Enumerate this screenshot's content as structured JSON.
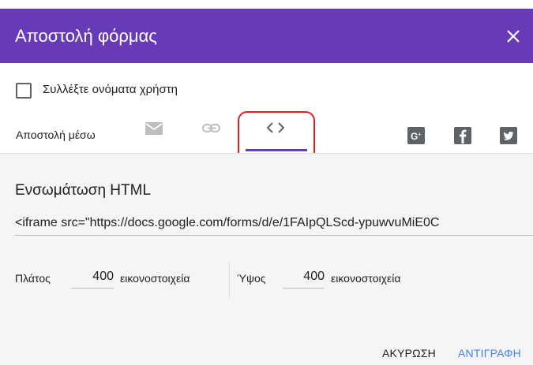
{
  "dialog": {
    "title": "Αποστολή φόρμας",
    "close_icon": "close-icon"
  },
  "collect_emails": {
    "label": "Συλλέξτε ονόματα χρήστη",
    "checked": false
  },
  "send_via": {
    "label": "Αποστολή μέσω",
    "tabs": [
      "email-icon",
      "link-icon",
      "embed-code-icon"
    ],
    "selected": "embed-code-icon",
    "social": [
      "google-plus-icon",
      "facebook-icon",
      "twitter-icon"
    ]
  },
  "embed": {
    "title": "Ενσωμάτωση HTML",
    "code": "<iframe src=\"https://docs.google.com/forms/d/e/1FAIpQLScd-ypuwvuMiE0C"
  },
  "dimensions": {
    "width_label": "Πλάτος",
    "width_value": "400",
    "width_unit": "εικονοστοιχεία",
    "height_label": "Ύψος",
    "height_value": "400",
    "height_unit": "εικονοστοιχεία"
  },
  "actions": {
    "cancel": "ΑΚΥΡΩΣΗ",
    "copy": "ΑΝΤΙΓΡΑΦΗ"
  },
  "colors": {
    "header": "#673ab7",
    "accent": "#4285f4",
    "highlight": "#e0201b"
  }
}
